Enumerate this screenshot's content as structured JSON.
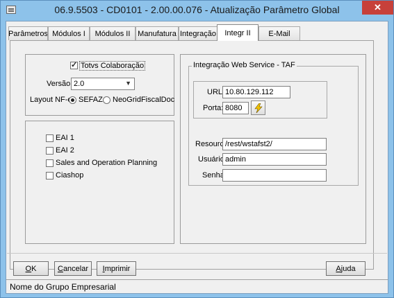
{
  "window": {
    "title": "06.9.5503 - CD0101 - 2.00.00.076 - Atualização Parâmetro Global",
    "close_glyph": "✕"
  },
  "tabs": [
    {
      "label": "Parâmetros"
    },
    {
      "label": "Módulos I"
    },
    {
      "label": "Módulos II"
    },
    {
      "label": "Manufatura"
    },
    {
      "label": "Integração"
    },
    {
      "label": "Integr II"
    },
    {
      "label": "E-Mail"
    }
  ],
  "active_tab": "Integr II",
  "colaboracao": {
    "checkbox_label": "Totvs Colaboração",
    "checked": true,
    "versao_label": "Versão:",
    "versao_value": "2.0",
    "layout_label": "Layout NF-e:",
    "layout_options": [
      {
        "label": "SEFAZ",
        "selected": true
      },
      {
        "label": "NeoGridFiscalDoc",
        "selected": false
      }
    ]
  },
  "eai": {
    "items": [
      {
        "label": "EAI 1",
        "checked": false
      },
      {
        "label": "EAI 2",
        "checked": false
      },
      {
        "label": "Sales and Operation Planning",
        "checked": false
      },
      {
        "label": "Ciashop",
        "checked": false
      }
    ]
  },
  "taf": {
    "legend": "Integração Web Service - TAF",
    "url_label": "URL:",
    "url_value": "10.80.129.112",
    "porta_label": "Porta:",
    "porta_value": "8080",
    "resource_label": "Resource:",
    "resource_value": "/rest/wstafst2/",
    "usuario_label": "Usuário:",
    "usuario_value": "admin",
    "senha_label": "Senha:",
    "senha_value": ""
  },
  "buttons": {
    "ok_key": "O",
    "ok_rest": "K",
    "cancelar_key": "C",
    "cancelar_rest": "ancelar",
    "imprimir_key": "I",
    "imprimir_rest": "mprimir",
    "ajuda_key": "A",
    "ajuda_rest": "juda"
  },
  "status": {
    "text": "Nome do Grupo Empresarial"
  },
  "colors": {
    "titlebar": "#8dc2ea",
    "close": "#c7403a",
    "bolt": "#f2c300"
  }
}
